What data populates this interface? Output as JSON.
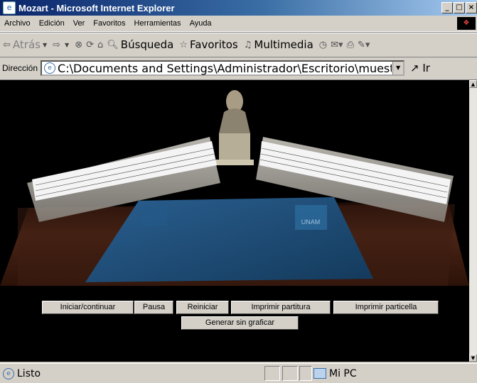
{
  "window": {
    "title": "Mozart - Microsoft Internet Explorer",
    "controls": [
      "_",
      "□",
      "×"
    ]
  },
  "menu": [
    "Archivo",
    "Edición",
    "Ver",
    "Favoritos",
    "Herramientas",
    "Ayuda"
  ],
  "toolbar": {
    "back": "Atrás",
    "search": "Búsqueda",
    "favorites": "Favoritos",
    "multimedia": "Multimedia"
  },
  "address": {
    "label": "Dirección",
    "value": "C:\\Documents and Settings\\Administrador\\Escritorio\\muestraTrabajo\\",
    "go": "Ir"
  },
  "content": {
    "scene_icons": [
      "bust-statue",
      "score-lectern-left",
      "score-lectern-right",
      "unam-blue-folder"
    ],
    "folder_text": "UNAM",
    "buttons_row1": [
      "Iniciar/continuar",
      "Pausa",
      "Reiniciar",
      "Imprimir partitura",
      "Imprimir particella"
    ],
    "buttons_row2": [
      "Generar sin graficar"
    ]
  },
  "status": {
    "text": "Listo",
    "zone": "Mi PC"
  },
  "colors": {
    "titlebar_start": "#0a246a",
    "chrome": "#d4d0c8",
    "content_bg": "#000000",
    "table": "#4a2416",
    "folder": "#1f4f7a"
  }
}
